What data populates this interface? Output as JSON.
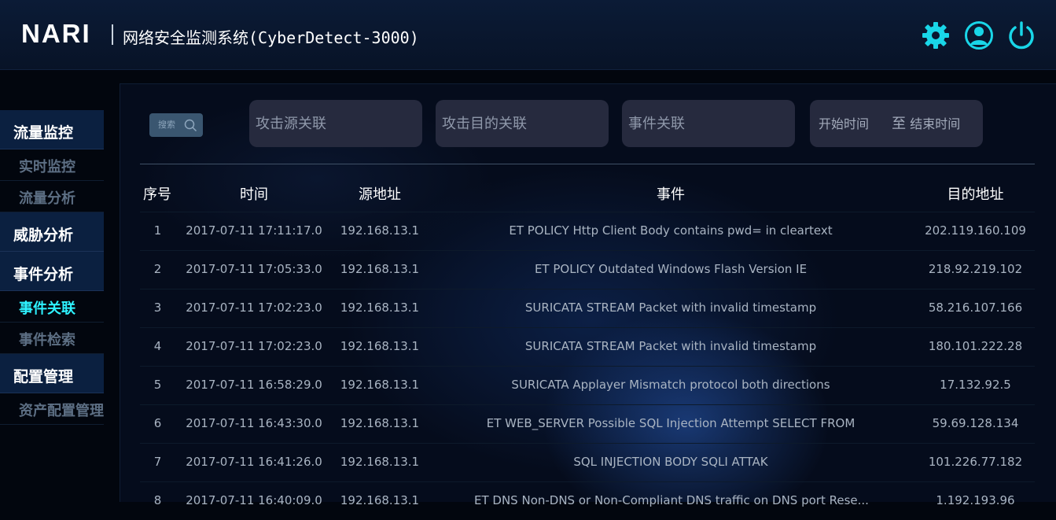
{
  "header": {
    "logo": "NARI",
    "title": "网络安全监测系统(CyberDetect-3000)",
    "icons": [
      "gear-icon",
      "user-icon",
      "power-icon"
    ],
    "accent_color": "#19d6e8"
  },
  "sidebar": {
    "groups": [
      {
        "label": "流量监控",
        "items": [
          {
            "label": "实时监控"
          },
          {
            "label": "流量分析"
          }
        ]
      },
      {
        "label": "威胁分析",
        "items": []
      },
      {
        "label": "事件分析",
        "items": [
          {
            "label": "事件关联",
            "active": true
          },
          {
            "label": "事件检索"
          }
        ]
      },
      {
        "label": "配置管理",
        "items": [
          {
            "label": "资产配置管理"
          }
        ]
      }
    ]
  },
  "filters": {
    "search_label": "搜索",
    "source_placeholder": "攻击源关联",
    "target_placeholder": "攻击目的关联",
    "event_placeholder": "事件关联",
    "start_time": "开始时间",
    "to": "至",
    "end_time": "结束时间"
  },
  "table": {
    "headers": {
      "idx": "序号",
      "time": "时间",
      "src": "源地址",
      "event": "事件",
      "dst": "目的地址"
    },
    "rows": [
      {
        "idx": "1",
        "time": "2017-07-11 17:11:17.0",
        "src": "192.168.13.1",
        "event": "ET POLICY Http Client Body contains pwd= in cleartext",
        "dst": "202.119.160.109"
      },
      {
        "idx": "2",
        "time": "2017-07-11 17:05:33.0",
        "src": "192.168.13.1",
        "event": "ET POLICY Outdated Windows Flash Version IE",
        "dst": "218.92.219.102"
      },
      {
        "idx": "3",
        "time": "2017-07-11 17:02:23.0",
        "src": "192.168.13.1",
        "event": "SURICATA STREAM Packet with invalid timestamp",
        "dst": "58.216.107.166"
      },
      {
        "idx": "4",
        "time": "2017-07-11 17:02:23.0",
        "src": "192.168.13.1",
        "event": "SURICATA STREAM Packet with invalid timestamp",
        "dst": "180.101.222.28"
      },
      {
        "idx": "5",
        "time": "2017-07-11 16:58:29.0",
        "src": "192.168.13.1",
        "event": "SURICATA Applayer Mismatch protocol both directions",
        "dst": "17.132.92.5"
      },
      {
        "idx": "6",
        "time": "2017-07-11 16:43:30.0",
        "src": "192.168.13.1",
        "event": "ET WEB_SERVER Possible SQL Injection Attempt SELECT FROM",
        "dst": "59.69.128.134"
      },
      {
        "idx": "7",
        "time": "2017-07-11 16:41:26.0",
        "src": "192.168.13.1",
        "event": "SQL INJECTION BODY SQLI ATTAK",
        "dst": "101.226.77.182"
      },
      {
        "idx": "8",
        "time": "2017-07-11 16:40:09.0",
        "src": "192.168.13.1",
        "event": "ET DNS Non-DNS or Non-Compliant DNS traffic on DNS port Rese...",
        "dst": "1.192.193.96"
      }
    ]
  }
}
